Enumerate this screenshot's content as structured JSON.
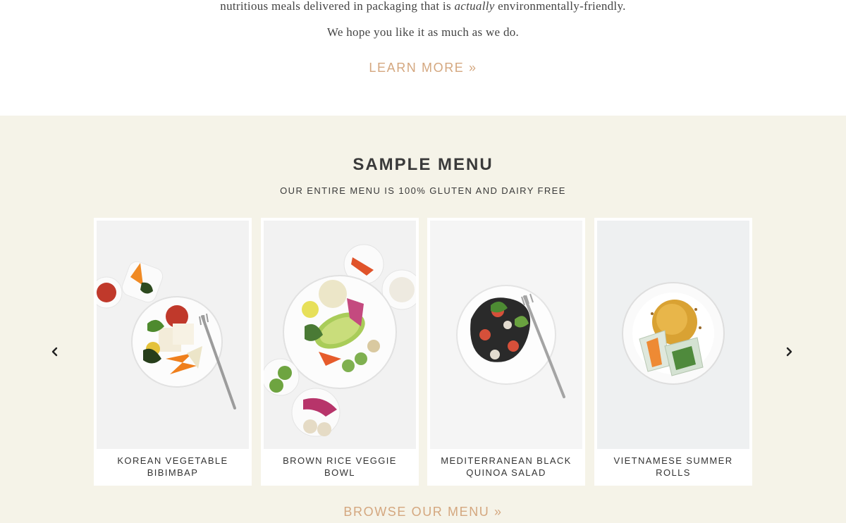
{
  "intro": {
    "line1_before": "nutritious meals delivered in packaging that is ",
    "line1_emphasis": "actually",
    "line1_after": " environmentally-friendly.",
    "line2": "We hope you like it as much as we do.",
    "learn_more": "LEARN MORE »"
  },
  "menu": {
    "title": "SAMPLE MENU",
    "subtitle": "OUR ENTIRE MENU IS 100% GLUTEN AND DAIRY FREE",
    "prev_icon": "chevron-left-icon",
    "next_icon": "chevron-right-icon",
    "items": [
      {
        "line1": "KOREAN VEGETABLE",
        "line2": "BIBIMBAP",
        "image": "bibimbap-photo"
      },
      {
        "line1": "BROWN RICE VEGGIE",
        "line2": "BOWL",
        "image": "veggie-bowl-photo"
      },
      {
        "line1": "MEDITERRANEAN BLACK",
        "line2": "QUINOA SALAD",
        "image": "quinoa-salad-photo"
      },
      {
        "line1": "VIETNAMESE SUMMER",
        "line2": "ROLLS",
        "image": "summer-rolls-photo"
      }
    ],
    "browse": "BROWSE OUR MENU »"
  },
  "colors": {
    "accent": "#d4a77f",
    "menu_background": "#f5f3e8",
    "heading": "#3a3a3a"
  }
}
